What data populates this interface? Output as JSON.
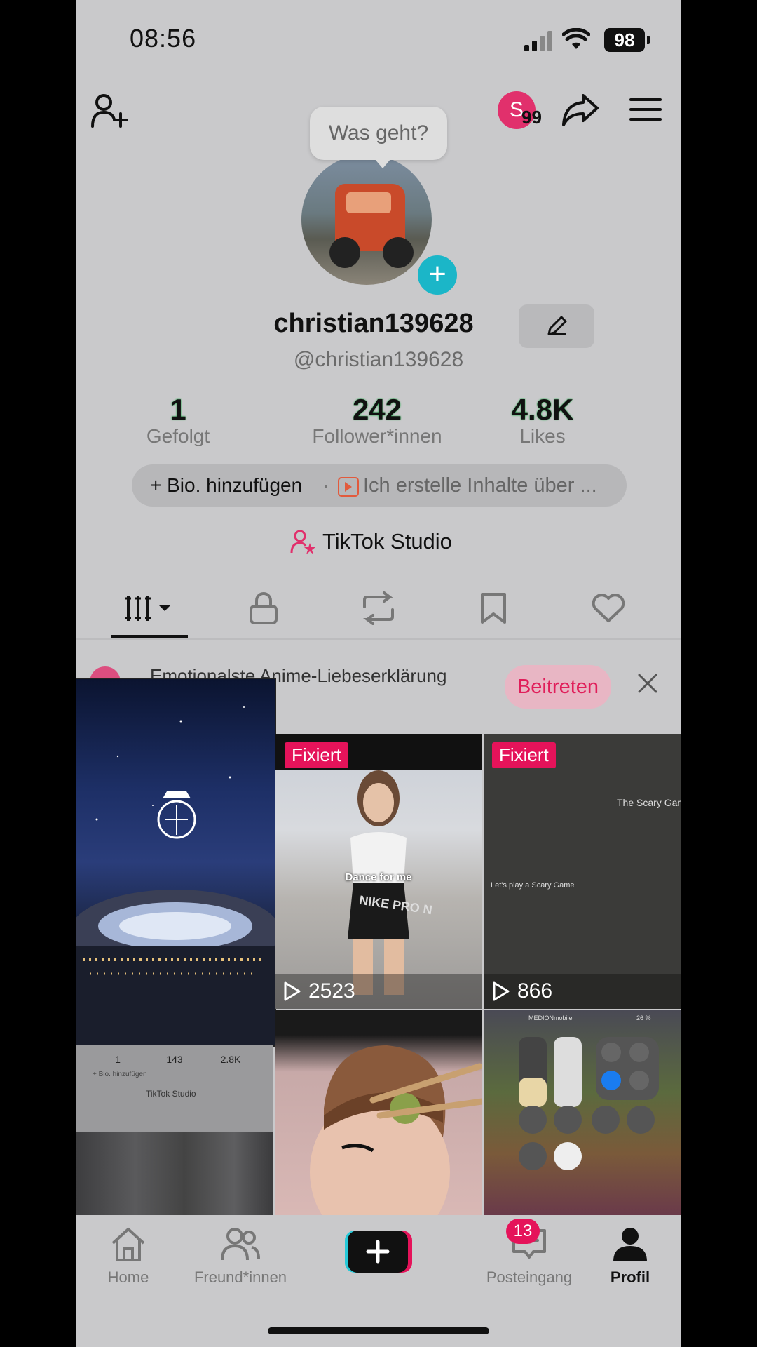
{
  "status": {
    "time": "08:56",
    "battery": "98"
  },
  "header": {
    "notif_initial": "S",
    "notif_count": "99"
  },
  "profile": {
    "status_bubble": "Was geht?",
    "username": "christian139628",
    "handle": "@christian139628",
    "stats": [
      {
        "value": "1",
        "label": "Gefolgt"
      },
      {
        "value": "242",
        "label": "Follower*innen"
      },
      {
        "value": "4.8K",
        "label": "Likes"
      }
    ],
    "bio_add": "+ Bio. hinzufügen",
    "bio_sep": "·",
    "bio_text": "Ich erstelle Inhalte über ...",
    "studio": "TikTok Studio"
  },
  "tabs": [
    "videos-grid",
    "private",
    "reposts",
    "favorites",
    "liked"
  ],
  "challenge": {
    "title": "Emotionalste Anime-Liebeserklärung",
    "join": "Beitreten"
  },
  "grid": [
    {
      "pinned": "Fixiert",
      "views": "2523",
      "caption": "Dance for me",
      "caption2": "NIKE PRO N"
    },
    {
      "pinned": "Fixiert",
      "views": "866",
      "caption": "The Scary Gam",
      "caption2": "Let's play a Scary Game"
    }
  ],
  "mini_stats": [
    "1",
    "143",
    "2.8K"
  ],
  "mini_studio": "TikTok Studio",
  "mini_bio": "+ Bio. hinzufügen",
  "control_center_top": "MEDIONmobile",
  "control_center_battery": "26 %",
  "nav": {
    "items": [
      {
        "label": "Home"
      },
      {
        "label": "Freund*innen"
      },
      {
        "label": ""
      },
      {
        "label": "Posteingang"
      },
      {
        "label": "Profil"
      }
    ],
    "inbox_badge": "13"
  }
}
